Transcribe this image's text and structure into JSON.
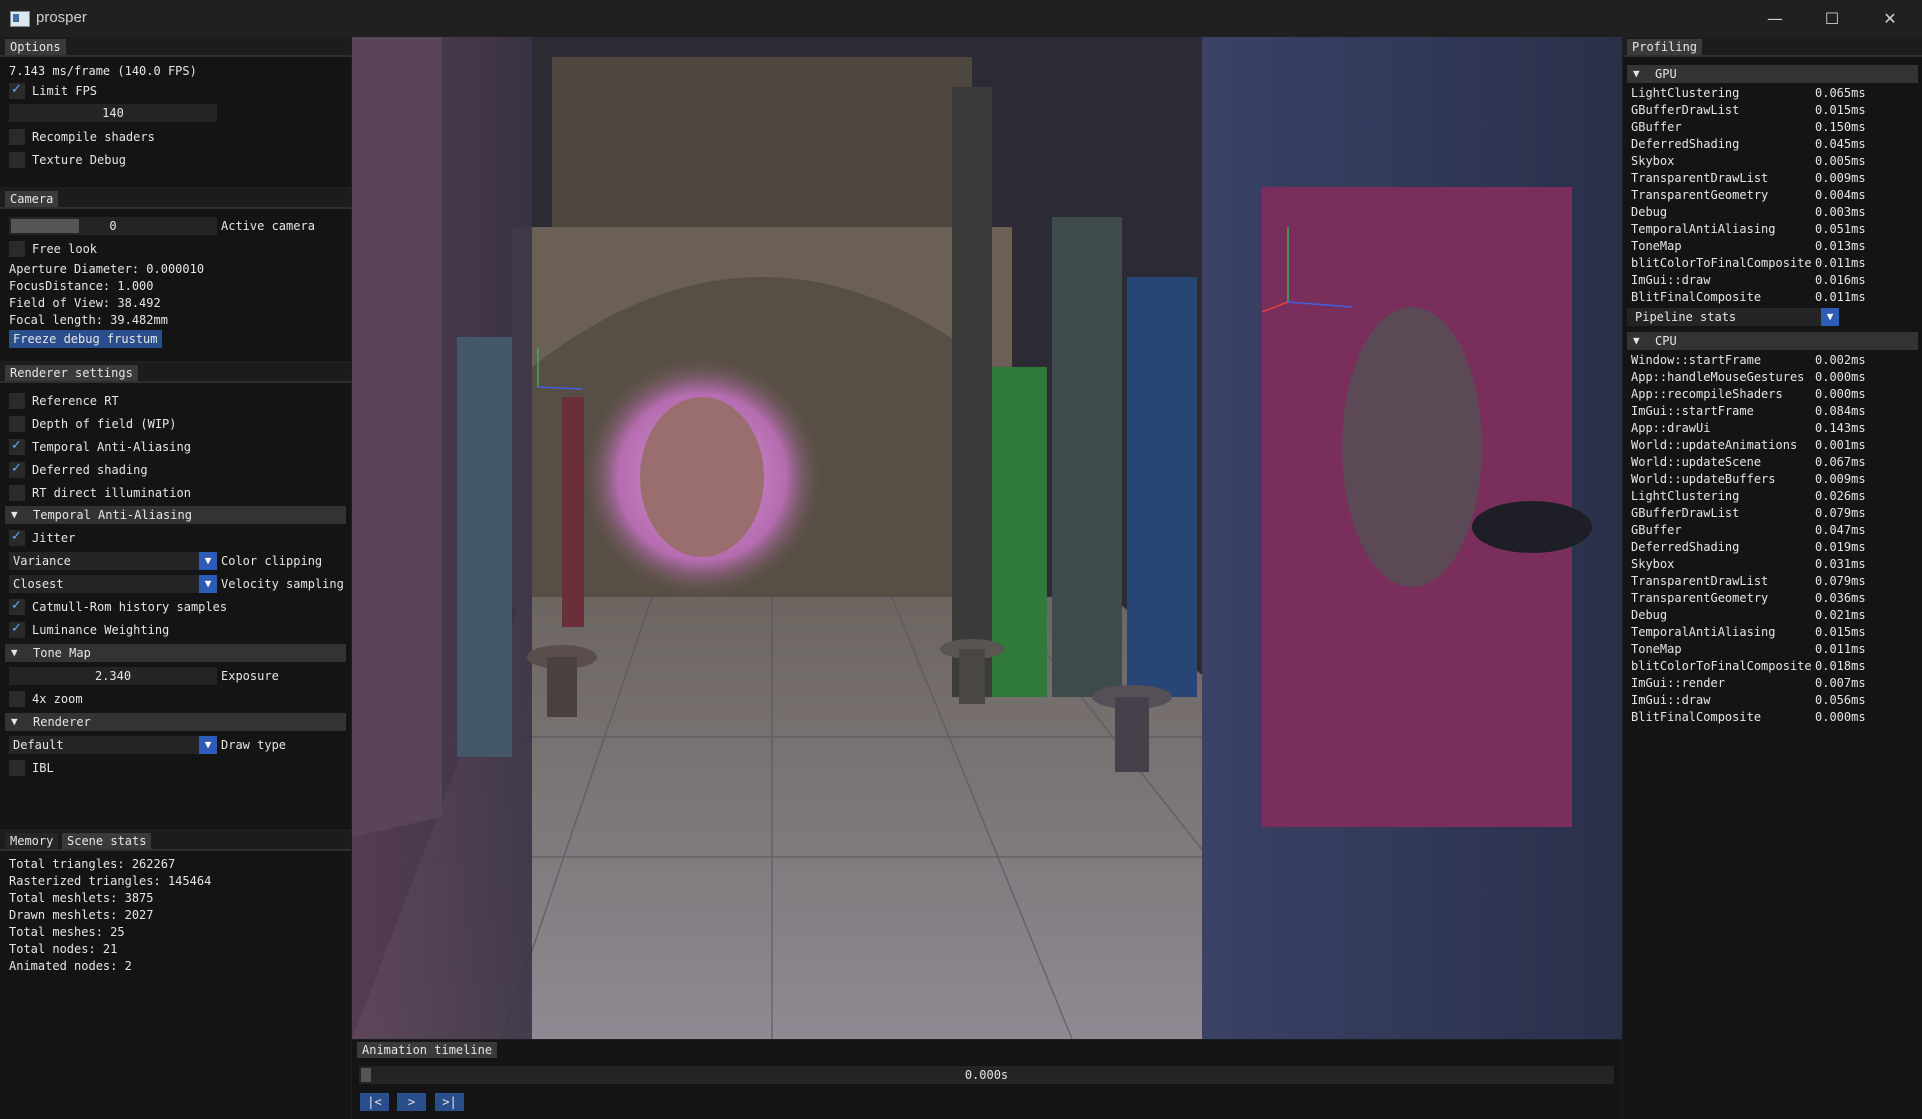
{
  "window": {
    "title": "prosper",
    "min": "—",
    "max": "☐",
    "close": "✕"
  },
  "options": {
    "tab": "Options",
    "frame_time": "7.143 ms/frame (140.0 FPS)",
    "limit_fps": "Limit FPS",
    "fps_value": "140",
    "recompile": "Recompile shaders",
    "texture_debug": "Texture Debug"
  },
  "camera": {
    "tab": "Camera",
    "active_value": "0",
    "active_label": "Active camera",
    "free_look": "Free look",
    "aperture": "Aperture Diameter: 0.000010",
    "focus": "FocusDistance: 1.000",
    "fov": "Field of View: 38.492",
    "focal": "Focal length: 39.482mm",
    "freeze_btn": "Freeze debug frustum"
  },
  "renderer": {
    "tab": "Renderer settings",
    "reference_rt": "Reference RT",
    "dof": "Depth of field (WIP)",
    "taa": "Temporal Anti-Aliasing",
    "deferred": "Deferred shading",
    "rt_direct": "RT direct illumination",
    "taa_header": "Temporal Anti-Aliasing",
    "jitter": "Jitter",
    "clip_value": "Variance",
    "clip_label": "Color clipping",
    "vel_value": "Closest",
    "vel_label": "Velocity sampling",
    "catmull": "Catmull-Rom history samples",
    "luminance": "Luminance Weighting",
    "tonemap_header": "Tone Map",
    "exposure_value": "2.340",
    "exposure_label": "Exposure",
    "zoom": "4x zoom",
    "renderer_header": "Renderer",
    "draw_value": "Default",
    "draw_label": "Draw type",
    "ibl": "IBL"
  },
  "stats": {
    "tab_memory": "Memory",
    "tab_scene": "Scene stats",
    "lines": [
      "Total triangles: 262267",
      "Rasterized triangles: 145464",
      "Total meshlets: 3875",
      "Drawn meshlets: 2027",
      "Total meshes: 25",
      "Total nodes: 21",
      "Animated nodes: 2"
    ]
  },
  "timeline": {
    "tab": "Animation timeline",
    "time": "0.000s",
    "btn_start": "|<",
    "btn_play": ">",
    "btn_end": ">|"
  },
  "profiling": {
    "tab": "Profiling",
    "gpu_header": "GPU",
    "gpu": [
      {
        "name": "LightClustering",
        "time": "0.065ms"
      },
      {
        "name": "GBufferDrawList",
        "time": "0.015ms"
      },
      {
        "name": "GBuffer",
        "time": "0.150ms"
      },
      {
        "name": "DeferredShading",
        "time": "0.045ms"
      },
      {
        "name": "Skybox",
        "time": "0.005ms"
      },
      {
        "name": "TransparentDrawList",
        "time": "0.009ms"
      },
      {
        "name": "TransparentGeometry",
        "time": "0.004ms"
      },
      {
        "name": "Debug",
        "time": "0.003ms"
      },
      {
        "name": "TemporalAntiAliasing",
        "time": "0.051ms"
      },
      {
        "name": "ToneMap",
        "time": "0.013ms"
      },
      {
        "name": "blitColorToFinalComposite",
        "time": "0.011ms"
      },
      {
        "name": "ImGui::draw",
        "time": "0.016ms"
      },
      {
        "name": "BlitFinalComposite",
        "time": "0.011ms"
      }
    ],
    "pipeline_stats": "Pipeline stats",
    "cpu_header": "CPU",
    "cpu": [
      {
        "name": "Window::startFrame",
        "time": "0.002ms"
      },
      {
        "name": "App::handleMouseGestures",
        "time": "0.000ms"
      },
      {
        "name": "App::recompileShaders",
        "time": "0.000ms"
      },
      {
        "name": "ImGui::startFrame",
        "time": "0.084ms"
      },
      {
        "name": "App::drawUi",
        "time": "0.143ms"
      },
      {
        "name": "World::updateAnimations",
        "time": "0.001ms"
      },
      {
        "name": "World::updateScene",
        "time": "0.067ms"
      },
      {
        "name": "World::updateBuffers",
        "time": "0.009ms"
      },
      {
        "name": "LightClustering",
        "time": "0.026ms"
      },
      {
        "name": "GBufferDrawList",
        "time": "0.079ms"
      },
      {
        "name": "GBuffer",
        "time": "0.047ms"
      },
      {
        "name": "DeferredShading",
        "time": "0.019ms"
      },
      {
        "name": "Skybox",
        "time": "0.031ms"
      },
      {
        "name": "TransparentDrawList",
        "time": "0.079ms"
      },
      {
        "name": "TransparentGeometry",
        "time": "0.036ms"
      },
      {
        "name": "Debug",
        "time": "0.021ms"
      },
      {
        "name": "TemporalAntiAliasing",
        "time": "0.015ms"
      },
      {
        "name": "ToneMap",
        "time": "0.011ms"
      },
      {
        "name": "blitColorToFinalComposite",
        "time": "0.018ms"
      },
      {
        "name": "ImGui::render",
        "time": "0.007ms"
      },
      {
        "name": "ImGui::draw",
        "time": "0.056ms"
      },
      {
        "name": "BlitFinalComposite",
        "time": "0.000ms"
      }
    ]
  }
}
